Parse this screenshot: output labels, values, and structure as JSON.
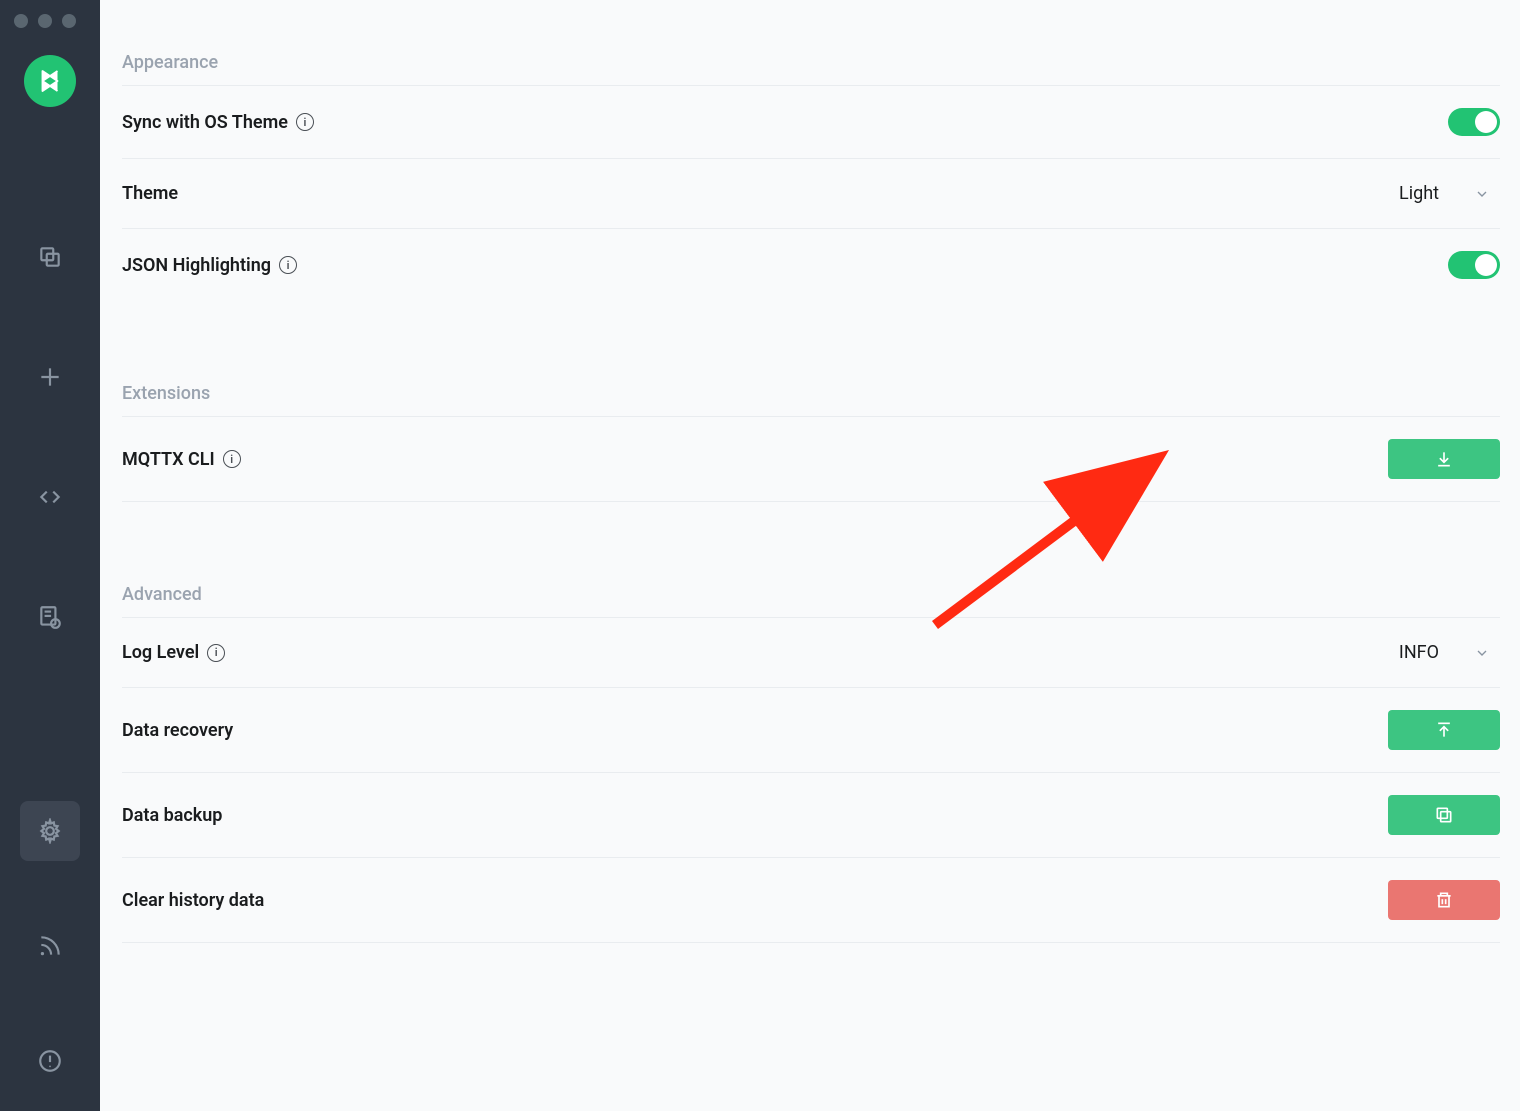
{
  "sections": {
    "appearance": {
      "title": "Appearance",
      "syncOsTheme": {
        "label": "Sync with OS Theme",
        "hasInfo": true,
        "enabled": true
      },
      "theme": {
        "label": "Theme",
        "value": "Light"
      },
      "jsonHighlighting": {
        "label": "JSON Highlighting",
        "hasInfo": true,
        "enabled": true
      }
    },
    "extensions": {
      "title": "Extensions",
      "mqttxCli": {
        "label": "MQTTX CLI",
        "hasInfo": true
      }
    },
    "advanced": {
      "title": "Advanced",
      "logLevel": {
        "label": "Log Level",
        "hasInfo": true,
        "value": "INFO"
      },
      "dataRecovery": {
        "label": "Data recovery"
      },
      "dataBackup": {
        "label": "Data backup"
      },
      "clearHistory": {
        "label": "Clear history data"
      }
    }
  }
}
